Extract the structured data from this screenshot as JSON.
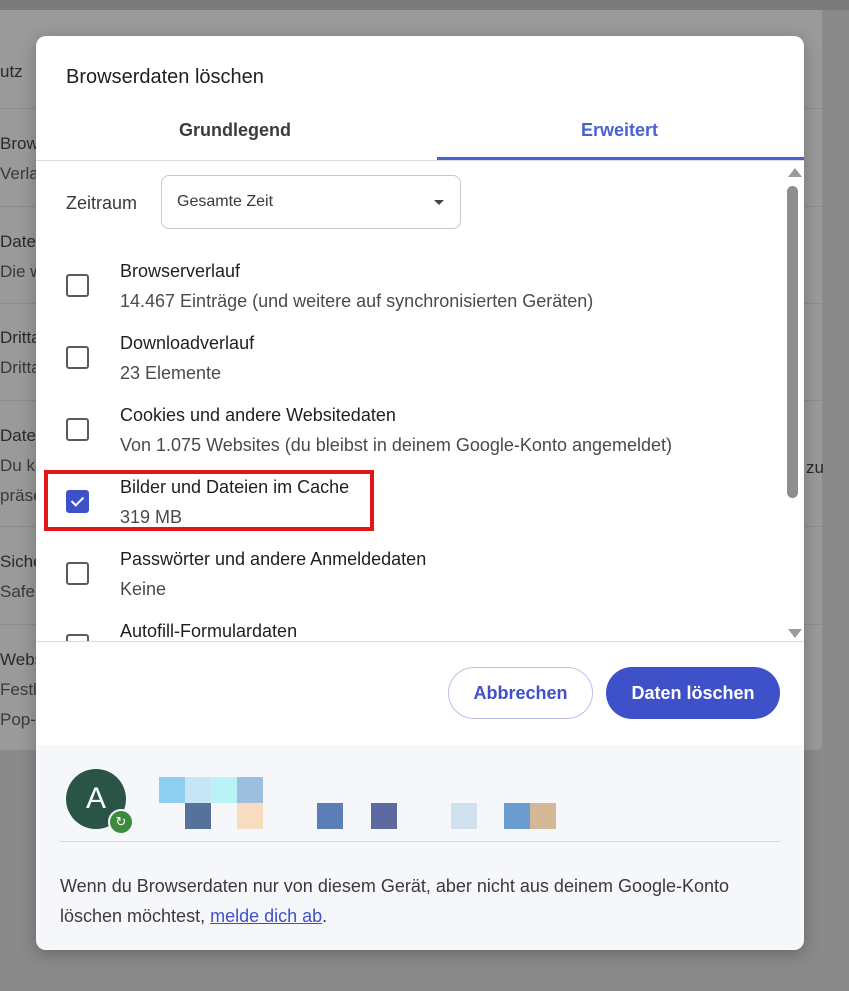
{
  "background": {
    "rows": [
      {
        "title": "Browserverlauf",
        "sub": "Verlauf"
      },
      {
        "title": "Daten",
        "sub": "Die w"
      },
      {
        "title": "Dritta",
        "sub": "Dritta"
      },
      {
        "title": "Daten",
        "sub": "Du ka"
      },
      {
        "title": "Sicher",
        "sub": "Safe"
      },
      {
        "title": "Webs",
        "sub": "Festl"
      }
    ],
    "header_fragment": "utz",
    "fragment_a": "präse",
    "fragment_b": "Pop-",
    "right_fragment": "zu"
  },
  "dialog": {
    "title": "Browserdaten löschen",
    "tabs": [
      {
        "label": "Grundlegend",
        "selected": false
      },
      {
        "label": "Erweitert",
        "selected": true
      }
    ],
    "time_range": {
      "label": "Zeitraum",
      "selected": "Gesamte Zeit"
    },
    "items": [
      {
        "title": "Browserverlauf",
        "sub": "14.467 Einträge (und weitere auf synchronisierten Geräten)",
        "checked": false
      },
      {
        "title": "Downloadverlauf",
        "sub": "23 Elemente",
        "checked": false
      },
      {
        "title": "Cookies und andere Websitedaten",
        "sub": "Von 1.075 Websites (du bleibst in deinem Google-Konto angemeldet)",
        "checked": false
      },
      {
        "title": "Bilder und Dateien im Cache",
        "sub": "319 MB",
        "checked": true
      },
      {
        "title": "Passwörter und andere Anmeldedaten",
        "sub": "Keine",
        "checked": false
      },
      {
        "title": "Autofill-Formulardaten",
        "sub": "",
        "checked": false
      }
    ],
    "buttons": {
      "cancel": "Abbrechen",
      "delete": "Daten löschen"
    },
    "account": {
      "avatar_letter": "A",
      "info_text_before": "Wenn du Browserdaten nur von diesem Gerät, aber nicht aus deinem Google-Konto löschen möchtest, ",
      "info_link": "melde dich ab",
      "info_text_after": "."
    }
  },
  "colors": {
    "accent": "#3f51c8",
    "tab_accent": "#4a62d0",
    "highlight_box": "#e0161b",
    "avatar_bg": "#2a5446",
    "sync_badge": "#3e8b3e"
  },
  "icons": [
    "dropdown-arrow-icon",
    "checkbox-check-icon",
    "sync-icon",
    "scroll-up-icon",
    "scroll-down-icon"
  ]
}
